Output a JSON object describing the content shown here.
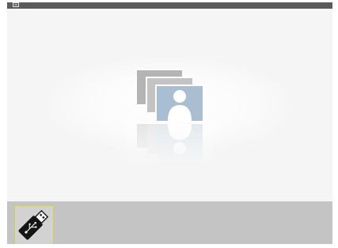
{
  "topbar": {
    "icon": "input-source-icon"
  },
  "main": {
    "icon": "photo-stack-icon"
  },
  "bottom_bar": {
    "items": [
      {
        "icon": "usb-drive-icon",
        "selected": true
      }
    ]
  },
  "colors": {
    "frame_background": "#f4f4f4",
    "topbar": "#5b5b5b",
    "bottom_bar": "#c4c4c4",
    "selection_border": "#d8d23a",
    "photo_front": "#a9bed0",
    "photo_back": "#b4b4b4"
  }
}
